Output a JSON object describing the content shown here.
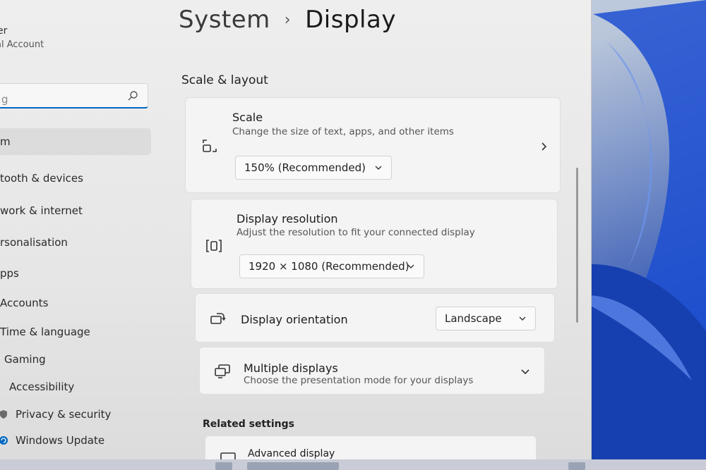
{
  "user": {
    "name": "er",
    "account_type": "al Account"
  },
  "search": {
    "placeholder": "g"
  },
  "nav": {
    "items": [
      {
        "label": "m"
      },
      {
        "label": "tooth & devices"
      },
      {
        "label": "work & internet"
      },
      {
        "label": "rsonalisation"
      },
      {
        "label": "pps"
      },
      {
        "label": "Accounts"
      },
      {
        "label": "Time & language"
      },
      {
        "label": "Gaming"
      },
      {
        "label": "Accessibility"
      },
      {
        "label": "Privacy & security"
      },
      {
        "label": "Windows Update"
      }
    ]
  },
  "breadcrumb": {
    "parent": "System",
    "separator": "›",
    "current": "Display"
  },
  "section": {
    "title": "Scale & layout"
  },
  "cards": {
    "scale": {
      "title": "Scale",
      "subtitle": "Change the size of text, apps, and other items",
      "value": "150% (Recommended)"
    },
    "resolution": {
      "title": "Display resolution",
      "subtitle": "Adjust the resolution to fit your connected display",
      "value": "1920 × 1080 (Recommended)"
    },
    "orientation": {
      "title": "Display orientation",
      "value": "Landscape"
    },
    "multiple": {
      "title": "Multiple displays",
      "subtitle": "Choose the presentation mode for your displays"
    },
    "advanced": {
      "title": "Advanced display"
    }
  },
  "related": {
    "title": "Related settings"
  },
  "colors": {
    "accent": "#0067c0",
    "window_bg": "#eeeeee",
    "card_bg": "#f4f4f4",
    "wallpaper_blue": "#2a4fb0"
  }
}
